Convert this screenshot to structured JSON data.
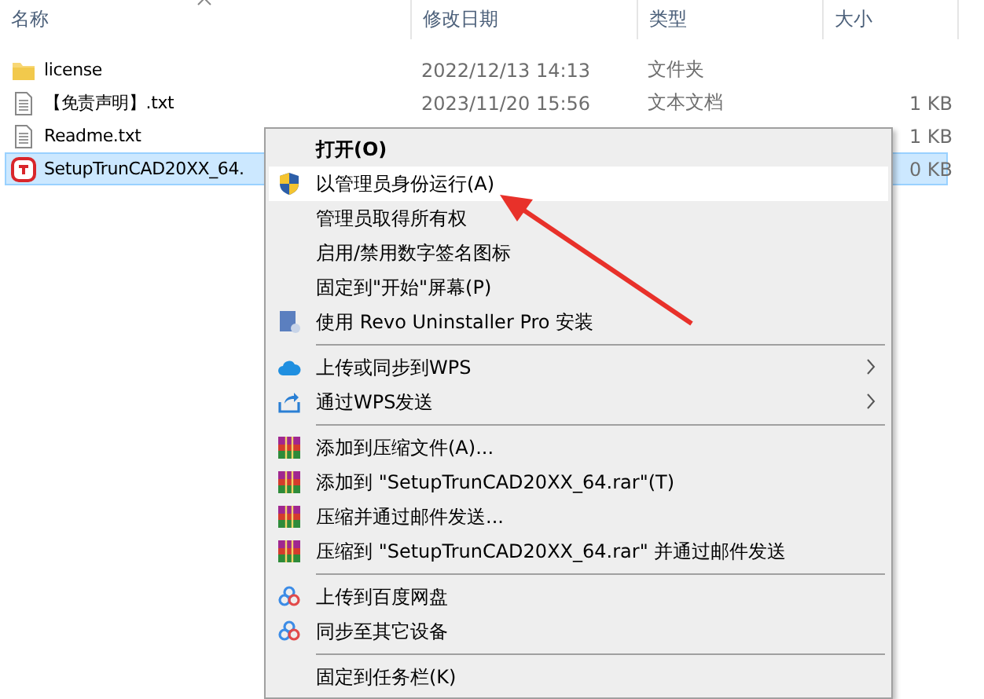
{
  "columns": [
    {
      "label": "名称"
    },
    {
      "label": "修改日期"
    },
    {
      "label": "类型"
    },
    {
      "label": "大小"
    }
  ],
  "files": [
    {
      "kind": "folder",
      "name": "license",
      "date": "2022/12/13 14:13",
      "type": "文件夹",
      "selected": false
    },
    {
      "kind": "text",
      "name": "【免责声明】.txt",
      "date": "2023/11/20 15:56",
      "type": "文本文档",
      "size": "1 KB",
      "selected": false
    },
    {
      "kind": "text",
      "name": "Readme.txt",
      "size": "1 KB",
      "selected": false
    },
    {
      "kind": "setup",
      "name": "SetupTrunCAD20XX_64.",
      "size": "0 KB",
      "selected": true
    }
  ],
  "context_menu": {
    "groups": [
      [
        {
          "kind": "none",
          "label": "打开(O)",
          "default": true,
          "highlighted": false,
          "submenu": false
        },
        {
          "kind": "shield",
          "label": "以管理员身份运行(A)",
          "default": false,
          "highlighted": true,
          "submenu": false
        },
        {
          "kind": "none",
          "label": "管理员取得所有权",
          "default": false,
          "highlighted": false,
          "submenu": false
        },
        {
          "kind": "none",
          "label": "启用/禁用数字签名图标",
          "default": false,
          "highlighted": false,
          "submenu": false
        },
        {
          "kind": "none",
          "label": "固定到\"开始\"屏幕(P)",
          "default": false,
          "highlighted": false,
          "submenu": false
        },
        {
          "kind": "revo",
          "label": "使用 Revo Uninstaller Pro 安装",
          "default": false,
          "highlighted": false,
          "submenu": false
        }
      ],
      [
        {
          "kind": "cloud",
          "label": "上传或同步到WPS",
          "default": false,
          "highlighted": false,
          "submenu": true
        },
        {
          "kind": "share",
          "label": "通过WPS发送",
          "default": false,
          "highlighted": false,
          "submenu": true
        }
      ],
      [
        {
          "kind": "archive",
          "label": "添加到压缩文件(A)...",
          "default": false,
          "highlighted": false,
          "submenu": false
        },
        {
          "kind": "archive",
          "label": "添加到 \"SetupTrunCAD20XX_64.rar\"(T)",
          "default": false,
          "highlighted": false,
          "submenu": false
        },
        {
          "kind": "archive",
          "label": "压缩并通过邮件发送...",
          "default": false,
          "highlighted": false,
          "submenu": false
        },
        {
          "kind": "archive",
          "label": "压缩到 \"SetupTrunCAD20XX_64.rar\" 并通过邮件发送",
          "default": false,
          "highlighted": false,
          "submenu": false
        }
      ],
      [
        {
          "kind": "netdisk",
          "label": "上传到百度网盘",
          "default": false,
          "highlighted": false,
          "submenu": false
        },
        {
          "kind": "netdisk",
          "label": "同步至其它设备",
          "default": false,
          "highlighted": false,
          "submenu": false
        }
      ],
      [
        {
          "kind": "none",
          "label": "固定到任务栏(K)",
          "default": false,
          "highlighted": false,
          "submenu": false
        }
      ]
    ]
  }
}
